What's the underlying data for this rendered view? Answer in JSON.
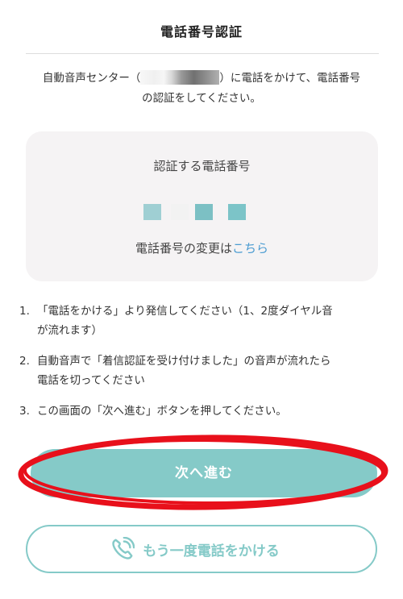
{
  "header": {
    "title": "電話番号認証"
  },
  "intro": {
    "prefix": "自動音声センター（",
    "suffix": "）に電話をかけて、電話番号",
    "line2": "の認証をしてください。"
  },
  "verify_card": {
    "title": "認証する電話番号",
    "change_text": "電話番号の変更は",
    "change_link": "こちら",
    "masked_colors": [
      "#9fcfd3",
      "#f2f2f2",
      "#7cc0c4",
      "#7cc4c8"
    ]
  },
  "steps": [
    {
      "number": "1.",
      "line1": "「電話をかける」より発信してください（1、2度ダイヤル音",
      "line2": "が流れます）"
    },
    {
      "number": "2.",
      "line1": "自動音声で「着信認証を受け付けました」の音声が流れたら",
      "line2": "電話を切ってください"
    },
    {
      "number": "3.",
      "line1": "この画面の「次へ進む」ボタンを押してください。",
      "line2": ""
    }
  ],
  "actions": {
    "next_label": "次へ進む",
    "call_again_label": "もう一度電話をかける"
  },
  "colors": {
    "accent": "#85cac8",
    "link": "#4a9bd1",
    "card_bg": "#f5f3f4",
    "annotation_red": "#e8101b"
  },
  "icons": {
    "call_icon": "phone-ringing-icon"
  }
}
